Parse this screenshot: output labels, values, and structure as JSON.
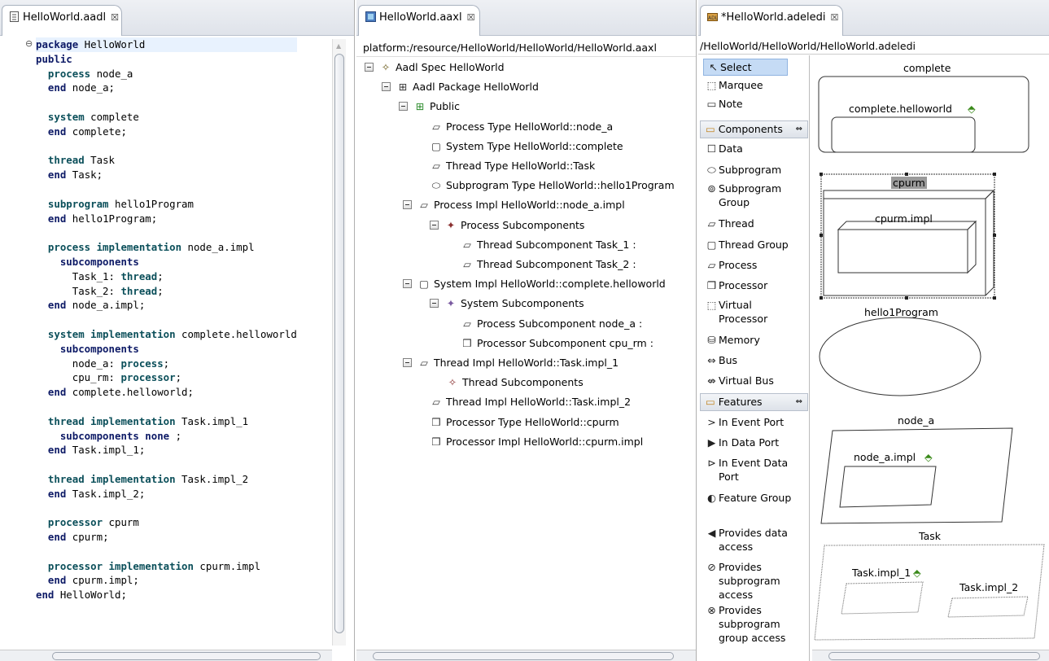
{
  "left_editor": {
    "tab_title": "HelloWorld.aadl",
    "code_lines": [
      [
        {
          "t": "package",
          "c": "kw"
        },
        {
          "t": " HelloWorld"
        }
      ],
      [
        {
          "t": "public",
          "c": "kw"
        }
      ],
      [
        {
          "t": "  "
        },
        {
          "t": "process",
          "c": "kb"
        },
        {
          "t": " node_a"
        }
      ],
      [
        {
          "t": "  "
        },
        {
          "t": "end",
          "c": "kw"
        },
        {
          "t": " node_a;"
        }
      ],
      [],
      [
        {
          "t": "  "
        },
        {
          "t": "system",
          "c": "kb"
        },
        {
          "t": " complete"
        }
      ],
      [
        {
          "t": "  "
        },
        {
          "t": "end",
          "c": "kw"
        },
        {
          "t": " complete;"
        }
      ],
      [],
      [
        {
          "t": "  "
        },
        {
          "t": "thread",
          "c": "kb"
        },
        {
          "t": " Task"
        }
      ],
      [
        {
          "t": "  "
        },
        {
          "t": "end",
          "c": "kw"
        },
        {
          "t": " Task;"
        }
      ],
      [],
      [
        {
          "t": "  "
        },
        {
          "t": "subprogram",
          "c": "kb"
        },
        {
          "t": " hello1Program"
        }
      ],
      [
        {
          "t": "  "
        },
        {
          "t": "end",
          "c": "kw"
        },
        {
          "t": " hello1Program;"
        }
      ],
      [],
      [
        {
          "t": "  "
        },
        {
          "t": "process implementation",
          "c": "kb"
        },
        {
          "t": " node_a.impl"
        }
      ],
      [
        {
          "t": "    "
        },
        {
          "t": "subcomponents",
          "c": "kw"
        }
      ],
      [
        {
          "t": "      Task_1: "
        },
        {
          "t": "thread",
          "c": "kb"
        },
        {
          "t": ";"
        }
      ],
      [
        {
          "t": "      Task_2: "
        },
        {
          "t": "thread",
          "c": "kb"
        },
        {
          "t": ";"
        }
      ],
      [
        {
          "t": "  "
        },
        {
          "t": "end",
          "c": "kw"
        },
        {
          "t": " node_a.impl;"
        }
      ],
      [],
      [
        {
          "t": "  "
        },
        {
          "t": "system implementation",
          "c": "kb"
        },
        {
          "t": " complete.helloworld"
        }
      ],
      [
        {
          "t": "    "
        },
        {
          "t": "subcomponents",
          "c": "kw"
        }
      ],
      [
        {
          "t": "      node_a: "
        },
        {
          "t": "process",
          "c": "kb"
        },
        {
          "t": ";"
        }
      ],
      [
        {
          "t": "      cpu_rm: "
        },
        {
          "t": "processor",
          "c": "kb"
        },
        {
          "t": ";"
        }
      ],
      [
        {
          "t": "  "
        },
        {
          "t": "end",
          "c": "kw"
        },
        {
          "t": " complete.helloworld;"
        }
      ],
      [],
      [
        {
          "t": "  "
        },
        {
          "t": "thread implementation",
          "c": "kb"
        },
        {
          "t": " Task.impl_1"
        }
      ],
      [
        {
          "t": "    "
        },
        {
          "t": "subcomponents none",
          "c": "kw"
        },
        {
          "t": " ;"
        }
      ],
      [
        {
          "t": "  "
        },
        {
          "t": "end",
          "c": "kw"
        },
        {
          "t": " Task.impl_1;"
        }
      ],
      [],
      [
        {
          "t": "  "
        },
        {
          "t": "thread implementation",
          "c": "kb"
        },
        {
          "t": " Task.impl_2"
        }
      ],
      [
        {
          "t": "  "
        },
        {
          "t": "end",
          "c": "kw"
        },
        {
          "t": " Task.impl_2;"
        }
      ],
      [],
      [
        {
          "t": "  "
        },
        {
          "t": "processor",
          "c": "kb"
        },
        {
          "t": " cpurm"
        }
      ],
      [
        {
          "t": "  "
        },
        {
          "t": "end",
          "c": "kw"
        },
        {
          "t": " cpurm;"
        }
      ],
      [],
      [
        {
          "t": "  "
        },
        {
          "t": "processor implementation",
          "c": "kb"
        },
        {
          "t": " cpurm.impl"
        }
      ],
      [
        {
          "t": "  "
        },
        {
          "t": "end",
          "c": "kw"
        },
        {
          "t": " cpurm.impl;"
        }
      ],
      [
        {
          "t": "end",
          "c": "kw"
        },
        {
          "t": " HelloWorld;"
        }
      ]
    ]
  },
  "middle_editor": {
    "tab_title": "HelloWorld.aaxl",
    "resource_path": "platform:/resource/HelloWorld/HelloWorld/HelloWorld.aaxl",
    "tree": [
      {
        "label": "Aadl Spec HelloWorld",
        "level": 0,
        "toggle": true,
        "icon": "aadl-spec-icon",
        "glyph": "✧"
      },
      {
        "label": "Aadl Package HelloWorld",
        "level": 1,
        "toggle": true,
        "icon": "package-icon",
        "glyph": "⊞"
      },
      {
        "label": "Public",
        "level": 2,
        "toggle": true,
        "icon": "public-section-icon",
        "glyph": "⊞"
      },
      {
        "label": "Process Type HelloWorld::node_a",
        "level": 3,
        "toggle": false,
        "icon": "process-icon",
        "glyph": "▱"
      },
      {
        "label": "System Type HelloWorld::complete",
        "level": 3,
        "toggle": false,
        "icon": "system-icon",
        "glyph": "▢"
      },
      {
        "label": "Thread Type HelloWorld::Task",
        "level": 3,
        "toggle": false,
        "icon": "thread-icon",
        "glyph": "▱"
      },
      {
        "label": "Subprogram Type HelloWorld::hello1Program",
        "level": 3,
        "toggle": false,
        "icon": "subprogram-icon",
        "glyph": "⬭"
      },
      {
        "label": "Process Impl HelloWorld::node_a.impl",
        "level": 2.4,
        "toggle": true,
        "icon": "process-impl-icon",
        "glyph": "▱"
      },
      {
        "label": "Process Subcomponents",
        "level": 3.4,
        "toggle": true,
        "icon": "subcomponents-icon",
        "glyph": "✦"
      },
      {
        "label": "Thread Subcomponent Task_1 :",
        "level": 4.4,
        "toggle": false,
        "icon": "thread-subcomponent-icon",
        "glyph": "▱"
      },
      {
        "label": "Thread Subcomponent Task_2 :",
        "level": 4.4,
        "toggle": false,
        "icon": "thread-subcomponent-icon",
        "glyph": "▱"
      },
      {
        "label": "System Impl HelloWorld::complete.helloworld",
        "level": 2.4,
        "toggle": true,
        "icon": "system-impl-icon",
        "glyph": "▢"
      },
      {
        "label": "System Subcomponents",
        "level": 3.4,
        "toggle": true,
        "icon": "subcomponents-icon",
        "glyph": "✦"
      },
      {
        "label": "Process Subcomponent node_a :",
        "level": 4.4,
        "toggle": false,
        "icon": "process-subcomponent-icon",
        "glyph": "▱"
      },
      {
        "label": "Processor Subcomponent cpu_rm :",
        "level": 4.4,
        "toggle": false,
        "icon": "processor-subcomponent-icon",
        "glyph": "❒"
      },
      {
        "label": "Thread Impl HelloWorld::Task.impl_1",
        "level": 2.4,
        "toggle": true,
        "icon": "thread-impl-icon",
        "glyph": "▱"
      },
      {
        "label": "Thread Subcomponents",
        "level": 3.4,
        "toggle": false,
        "icon": "subcomponents-icon",
        "glyph": "✧"
      },
      {
        "label": "Thread Impl HelloWorld::Task.impl_2",
        "level": 3,
        "toggle": false,
        "icon": "thread-impl-icon",
        "glyph": "▱"
      },
      {
        "label": "Processor Type HelloWorld::cpurm",
        "level": 3,
        "toggle": false,
        "icon": "processor-icon",
        "glyph": "❒"
      },
      {
        "label": "Processor Impl HelloWorld::cpurm.impl",
        "level": 3,
        "toggle": false,
        "icon": "processor-impl-icon",
        "glyph": "❒"
      }
    ]
  },
  "right_editor": {
    "tab_title": "*HelloWorld.adeledi",
    "path": "/HelloWorld/HelloWorld/HelloWorld.adeledi",
    "palette": {
      "tools": [
        {
          "label": "Select",
          "glyph": "↖",
          "icon": "select-arrow-icon"
        },
        {
          "label": "Marquee",
          "glyph": "⬚",
          "icon": "marquee-icon"
        },
        {
          "label": "Note",
          "glyph": "▭",
          "icon": "note-icon"
        }
      ],
      "components_header": "Components",
      "components": [
        {
          "label": "Data",
          "glyph": "☐",
          "icon": "data-icon"
        },
        {
          "label": "Subprogram",
          "glyph": "⬭",
          "icon": "subprogram-icon"
        },
        {
          "label": "Subprogram Group",
          "glyph": "⊚",
          "icon": "subprogram-group-icon"
        },
        {
          "label": "Thread",
          "glyph": "▱",
          "icon": "thread-icon"
        },
        {
          "label": "Thread Group",
          "glyph": "▢",
          "icon": "thread-group-icon"
        },
        {
          "label": "Process",
          "glyph": "▱",
          "icon": "process-icon"
        },
        {
          "label": "Processor",
          "glyph": "❒",
          "icon": "processor-icon"
        },
        {
          "label": "Virtual Processor",
          "glyph": "⬚",
          "icon": "virtual-processor-icon"
        },
        {
          "label": "Memory",
          "glyph": "⛁",
          "icon": "memory-icon"
        },
        {
          "label": "Bus",
          "glyph": "⇔",
          "icon": "bus-icon"
        },
        {
          "label": "Virtual Bus",
          "glyph": "⇎",
          "icon": "virtual-bus-icon"
        }
      ],
      "features_header": "Features",
      "features": [
        {
          "label": "In Event Port",
          "glyph": ">",
          "icon": "in-event-port-icon"
        },
        {
          "label": "In Data Port",
          "glyph": "▶",
          "icon": "in-data-port-icon"
        },
        {
          "label": "In Event Data Port",
          "glyph": "⊳",
          "icon": "in-event-data-port-icon"
        },
        {
          "label": "Feature Group",
          "glyph": "◐",
          "icon": "feature-group-icon"
        },
        {
          "label": "Provides data access",
          "glyph": "◀",
          "icon": "provides-data-access-icon"
        },
        {
          "label": "Provides subprogram access",
          "glyph": "⊘",
          "icon": "provides-subprogram-access-icon"
        },
        {
          "label": "Provides subprogram group access",
          "glyph": "⊗",
          "icon": "provides-subprogram-group-access-icon"
        }
      ]
    },
    "diagram": {
      "complete_label": "complete",
      "complete_impl": "complete.helloworld",
      "cpurm_label": "cpurm",
      "cpurm_impl": "cpurm.impl",
      "hello_label": "hello1Program",
      "node_label": "node_a",
      "node_impl": "node_a.impl",
      "task_label": "Task",
      "task_impl1": "Task.impl_1",
      "task_impl2": "Task.impl_2"
    }
  },
  "colors": {
    "keyword": "#0d1a66",
    "keyword_alt": "#0b4f5a",
    "selection": "#c5dbf5",
    "link_arrow": "#3a8a1a"
  }
}
